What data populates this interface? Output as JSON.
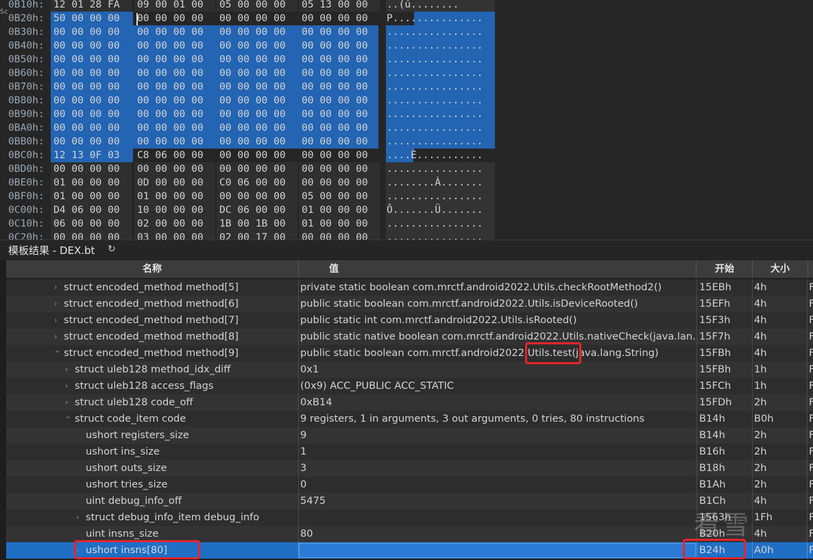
{
  "hex_view": {
    "rows": [
      {
        "addr": "0B10h:",
        "bytes": [
          "12 01 28 FA",
          "09 00 01 00",
          "05 00 00 00",
          "05 13 00 00"
        ],
        "ascii": "..(ú........"
      },
      {
        "addr": "0B20h:",
        "bytes": [
          "50 00 00 00",
          "00 00 00 00",
          "00 00 00 00",
          "00 00 00 00"
        ],
        "ascii": "P..............."
      },
      {
        "addr": "0B30h:",
        "bytes": [
          "00 00 00 00",
          "00 00 00 00",
          "00 00 00 00",
          "00 00 00 00"
        ],
        "ascii": "................"
      },
      {
        "addr": "0B40h:",
        "bytes": [
          "00 00 00 00",
          "00 00 00 00",
          "00 00 00 00",
          "00 00 00 00"
        ],
        "ascii": "................"
      },
      {
        "addr": "0B50h:",
        "bytes": [
          "00 00 00 00",
          "00 00 00 00",
          "00 00 00 00",
          "00 00 00 00"
        ],
        "ascii": "................"
      },
      {
        "addr": "0B60h:",
        "bytes": [
          "00 00 00 00",
          "00 00 00 00",
          "00 00 00 00",
          "00 00 00 00"
        ],
        "ascii": "................"
      },
      {
        "addr": "0B70h:",
        "bytes": [
          "00 00 00 00",
          "00 00 00 00",
          "00 00 00 00",
          "00 00 00 00"
        ],
        "ascii": "................"
      },
      {
        "addr": "0B80h:",
        "bytes": [
          "00 00 00 00",
          "00 00 00 00",
          "00 00 00 00",
          "00 00 00 00"
        ],
        "ascii": "................"
      },
      {
        "addr": "0B90h:",
        "bytes": [
          "00 00 00 00",
          "00 00 00 00",
          "00 00 00 00",
          "00 00 00 00"
        ],
        "ascii": "................"
      },
      {
        "addr": "0BA0h:",
        "bytes": [
          "00 00 00 00",
          "00 00 00 00",
          "00 00 00 00",
          "00 00 00 00"
        ],
        "ascii": "................"
      },
      {
        "addr": "0BB0h:",
        "bytes": [
          "00 00 00 00",
          "00 00 00 00",
          "00 00 00 00",
          "00 00 00 00"
        ],
        "ascii": "................"
      },
      {
        "addr": "0BC0h:",
        "bytes": [
          "12 13 0F 03",
          "C8 06 00 00",
          "00 00 00 00",
          "00 00 00 00"
        ],
        "ascii": "....È..........."
      },
      {
        "addr": "0BD0h:",
        "bytes": [
          "00 00 00 00",
          "00 00 00 00",
          "00 00 00 00",
          "00 00 00 00"
        ],
        "ascii": "................"
      },
      {
        "addr": "0BE0h:",
        "bytes": [
          "01 00 00 00",
          "0D 00 00 00",
          "C0 06 00 00",
          "00 00 00 00"
        ],
        "ascii": "........À......."
      },
      {
        "addr": "0BF0h:",
        "bytes": [
          "01 00 00 00",
          "01 00 00 00",
          "00 00 00 00",
          "05 00 00 00"
        ],
        "ascii": "................"
      },
      {
        "addr": "0C00h:",
        "bytes": [
          "D4 06 00 00",
          "10 00 00 00",
          "DC 06 00 00",
          "01 00 00 00"
        ],
        "ascii": "Ô.......Ü......."
      },
      {
        "addr": "0C10h:",
        "bytes": [
          "06 00 00 00",
          "02 00 00 00",
          "1B 00 1B 00",
          "01 00 00 00"
        ],
        "ascii": "................"
      },
      {
        "addr": "0C20h:",
        "bytes": [
          "00 00 00 00",
          "03 00 00 00",
          "02 00 17 00",
          "00 00 00 00"
        ],
        "ascii": "................"
      }
    ]
  },
  "template_panel": {
    "title": "模板结果 - DEX.bt",
    "refresh_icon": "↻",
    "columns": {
      "name": "名称",
      "value": "值",
      "start": "开始",
      "size": "大小"
    },
    "rows": [
      {
        "indent": 0,
        "expander": "collapsed",
        "name": "struct encoded_method method[5]",
        "value": "private static boolean com.mrctf.android2022.Utils.checkRootMethod2()",
        "start": "15EBh",
        "size": "4h",
        "extra": "F"
      },
      {
        "indent": 0,
        "expander": "collapsed",
        "name": "struct encoded_method method[6]",
        "value": "public static boolean com.mrctf.android2022.Utils.isDeviceRooted()",
        "start": "15EFh",
        "size": "4h",
        "extra": "F"
      },
      {
        "indent": 0,
        "expander": "collapsed",
        "name": "struct encoded_method method[7]",
        "value": "public static int com.mrctf.android2022.Utils.isRooted()",
        "start": "15F3h",
        "size": "4h",
        "extra": "F"
      },
      {
        "indent": 0,
        "expander": "collapsed",
        "name": "struct encoded_method method[8]",
        "value": "public static native boolean com.mrctf.android2022.Utils.nativeCheck(java.lan...",
        "start": "15F7h",
        "size": "4h",
        "extra": "F"
      },
      {
        "indent": 0,
        "expander": "expanded",
        "name": "struct encoded_method method[9]",
        "value": "public static boolean com.mrctf.android2022.Utils.test(java.lang.String)",
        "start": "15FBh",
        "size": "4h",
        "extra": "F"
      },
      {
        "indent": 1,
        "expander": "collapsed",
        "name": "struct uleb128 method_idx_diff",
        "value": "0x1",
        "start": "15FBh",
        "size": "1h",
        "extra": "F"
      },
      {
        "indent": 1,
        "expander": "collapsed",
        "name": "struct uleb128 access_flags",
        "value": "(0x9) ACC_PUBLIC ACC_STATIC",
        "start": "15FCh",
        "size": "1h",
        "extra": "F"
      },
      {
        "indent": 1,
        "expander": "collapsed",
        "name": "struct uleb128 code_off",
        "value": "0xB14",
        "start": "15FDh",
        "size": "2h",
        "extra": "F"
      },
      {
        "indent": 1,
        "expander": "expanded",
        "name": "struct code_item code",
        "value": "9 registers, 1 in arguments, 3 out arguments, 0 tries, 80 instructions",
        "start": "B14h",
        "size": "B0h",
        "extra": "F"
      },
      {
        "indent": 2,
        "expander": "none",
        "name": "ushort registers_size",
        "value": "9",
        "start": "B14h",
        "size": "2h",
        "extra": "F"
      },
      {
        "indent": 2,
        "expander": "none",
        "name": "ushort ins_size",
        "value": "1",
        "start": "B16h",
        "size": "2h",
        "extra": "F"
      },
      {
        "indent": 2,
        "expander": "none",
        "name": "ushort outs_size",
        "value": "3",
        "start": "B18h",
        "size": "2h",
        "extra": "F"
      },
      {
        "indent": 2,
        "expander": "none",
        "name": "ushort tries_size",
        "value": "0",
        "start": "B1Ah",
        "size": "2h",
        "extra": "F"
      },
      {
        "indent": 2,
        "expander": "none",
        "name": "uint debug_info_off",
        "value": "5475",
        "start": "B1Ch",
        "size": "4h",
        "extra": "F"
      },
      {
        "indent": 2,
        "expander": "collapsed",
        "name": "struct debug_info_item debug_info",
        "value": "",
        "start": "1563h",
        "size": "1Fh",
        "extra": "F"
      },
      {
        "indent": 2,
        "expander": "none",
        "name": "uint insns_size",
        "value": "80",
        "start": "B20h",
        "size": "4h",
        "extra": "F"
      },
      {
        "indent": 2,
        "expander": "collapsed",
        "name": "ushort insns[80]",
        "value": "",
        "start": "B24h",
        "size": "A0h",
        "extra": "F",
        "selected": true
      }
    ]
  },
  "watermark": "看雪",
  "colors": {
    "selection": "#2364b3",
    "row_selected": "#1f6fc5",
    "annotation": "#e8242b"
  }
}
